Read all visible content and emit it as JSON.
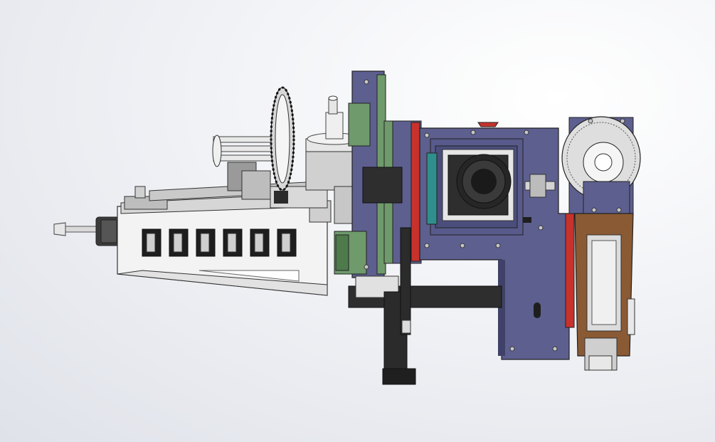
{
  "viewport": {
    "background_top": "#ffffff",
    "background_bottom": "#dfe2e9"
  },
  "palette": {
    "steel_blue": "#5d5f8f",
    "steel_blue_dark": "#3f4168",
    "green_plate": "#6f9a6c",
    "green_dark": "#4e7a4c",
    "white_part": "#f2f2f2",
    "grey_part": "#b9b9b9",
    "dark_part": "#2e2e2e",
    "brown_part": "#8a5a34",
    "red_part": "#c8322c",
    "teal_part": "#2f8f8c"
  },
  "icons": [
    "gear-wheel-icon",
    "camera-lens-icon",
    "pulley-icon",
    "pneumatic-cylinder-icon"
  ]
}
